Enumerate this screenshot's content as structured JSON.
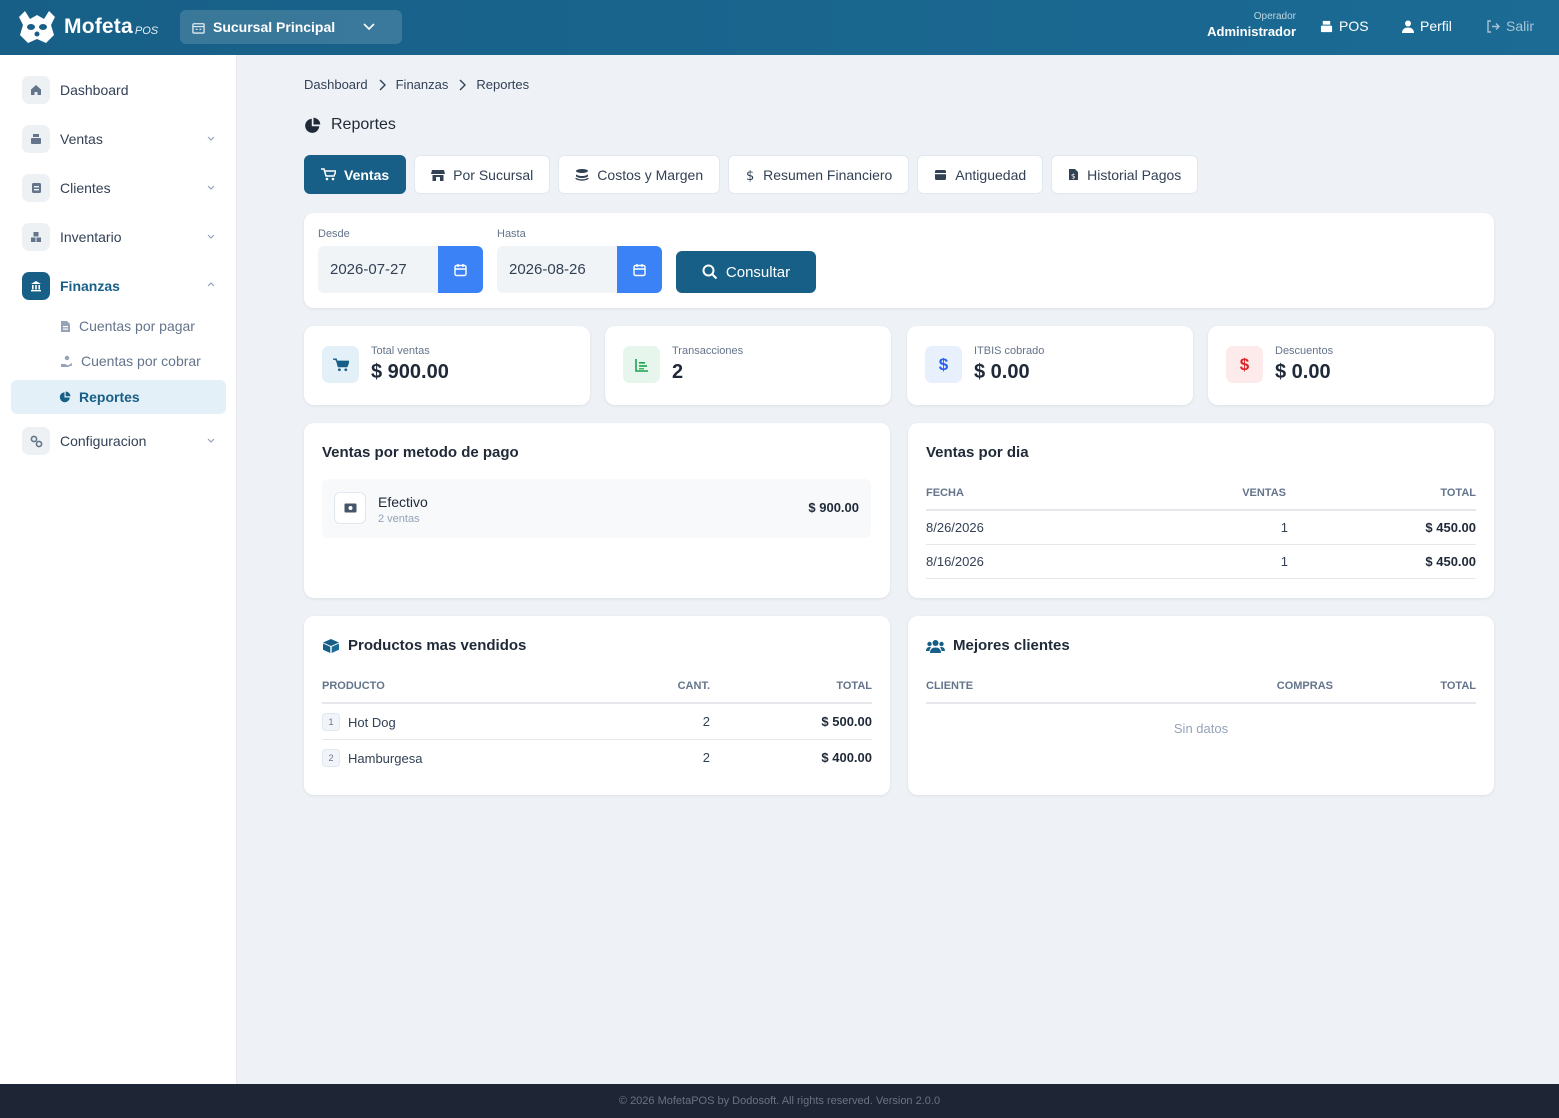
{
  "app": {
    "brand": "Mofeta",
    "brand_suffix": "POS"
  },
  "header": {
    "branch": "Sucursal Principal",
    "operator_label": "Operador",
    "operator_name": "Administrador",
    "nav": {
      "pos": "POS",
      "profile": "Perfil",
      "logout": "Salir"
    }
  },
  "sidebar": {
    "items": [
      {
        "label": "Dashboard",
        "icon": "home-icon"
      },
      {
        "label": "Ventas",
        "icon": "register-icon"
      },
      {
        "label": "Clientes",
        "icon": "contact-card-icon"
      },
      {
        "label": "Inventario",
        "icon": "boxes-icon"
      },
      {
        "label": "Finanzas",
        "icon": "bank-icon"
      },
      {
        "label": "Configuracion",
        "icon": "gears-icon"
      }
    ],
    "finanzas_sub": [
      "Cuentas por pagar",
      "Cuentas por cobrar",
      "Reportes"
    ]
  },
  "breadcrumb": [
    "Dashboard",
    "Finanzas",
    "Reportes"
  ],
  "page": {
    "title": "Reportes"
  },
  "tabs": [
    "Ventas",
    "Por Sucursal",
    "Costos y Margen",
    "Resumen Financiero",
    "Antiguedad",
    "Historial Pagos"
  ],
  "filters": {
    "from_label": "Desde",
    "from_value": "2026-07-27",
    "to_label": "Hasta",
    "to_value": "2026-08-26",
    "submit": "Consultar"
  },
  "stats": [
    {
      "label": "Total ventas",
      "value": "$ 900.00",
      "color": "#175f87"
    },
    {
      "label": "Transacciones",
      "value": "2",
      "color": "#16a34a"
    },
    {
      "label": "ITBIS cobrado",
      "value": "$ 0.00",
      "color": "#2563eb"
    },
    {
      "label": "Descuentos",
      "value": "$ 0.00",
      "color": "#dc2626"
    }
  ],
  "payment_methods": {
    "title": "Ventas por metodo de pago",
    "rows": [
      {
        "name": "Efectivo",
        "count": "2 ventas",
        "total": "$ 900.00"
      }
    ]
  },
  "daily_sales": {
    "title": "Ventas por dia",
    "headers": [
      "Fecha",
      "Ventas",
      "Total"
    ],
    "rows": [
      {
        "date": "8/26/2026",
        "sales": "1",
        "total": "$ 450.00"
      },
      {
        "date": "8/16/2026",
        "sales": "1",
        "total": "$ 450.00"
      }
    ]
  },
  "top_products": {
    "title": "Productos mas vendidos",
    "headers": [
      "Producto",
      "Cant.",
      "Total"
    ],
    "rows": [
      {
        "rank": "1",
        "name": "Hot Dog",
        "qty": "2",
        "total": "$ 500.00"
      },
      {
        "rank": "2",
        "name": "Hamburgesa",
        "qty": "2",
        "total": "$ 400.00"
      }
    ]
  },
  "top_clients": {
    "title": "Mejores clientes",
    "headers": [
      "Cliente",
      "Compras",
      "Total"
    ],
    "empty": "Sin datos"
  },
  "footer": "© 2026 MofetaPOS by Dodosoft. All rights reserved. Version 2.0.0"
}
